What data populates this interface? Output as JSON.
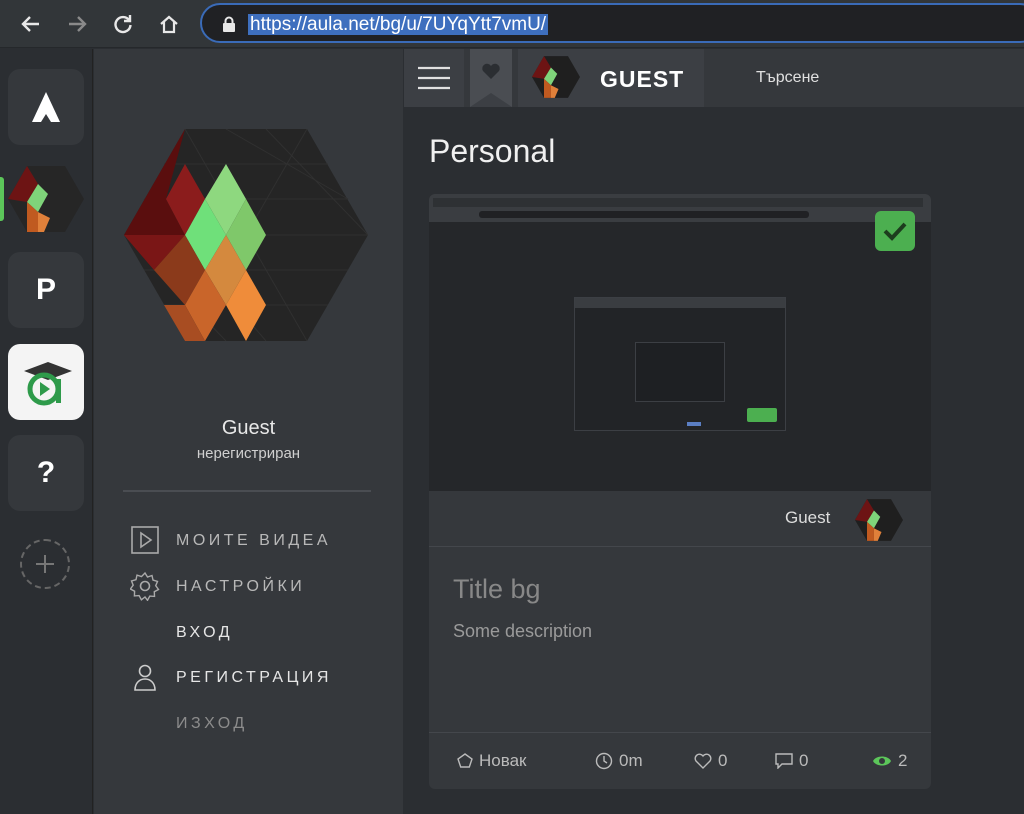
{
  "browser": {
    "url": "https://aula.net/bg/u/7UYqYtt7vmU/"
  },
  "rail": {
    "tiles": [
      "A",
      "",
      "P",
      "",
      "?"
    ]
  },
  "profile": {
    "name": "Guest",
    "status": "нерегистриран",
    "menu": [
      "МОИТЕ ВИДЕА",
      "НАСТРОЙКИ",
      "ВХОД",
      "РЕГИСТРАЦИЯ",
      "ИЗХОД"
    ]
  },
  "topbar": {
    "user": "GUEST",
    "search": "Търсене"
  },
  "page": {
    "title": "Personal"
  },
  "card": {
    "author": "Guest",
    "title": "Title bg",
    "description": "Some description",
    "footer": {
      "category": "Новак",
      "duration": "0m",
      "likes": "0",
      "comments": "0",
      "views": "2"
    }
  },
  "colors": {
    "accent": "#5cc65a",
    "url_highlight": "#3e6fbe"
  }
}
